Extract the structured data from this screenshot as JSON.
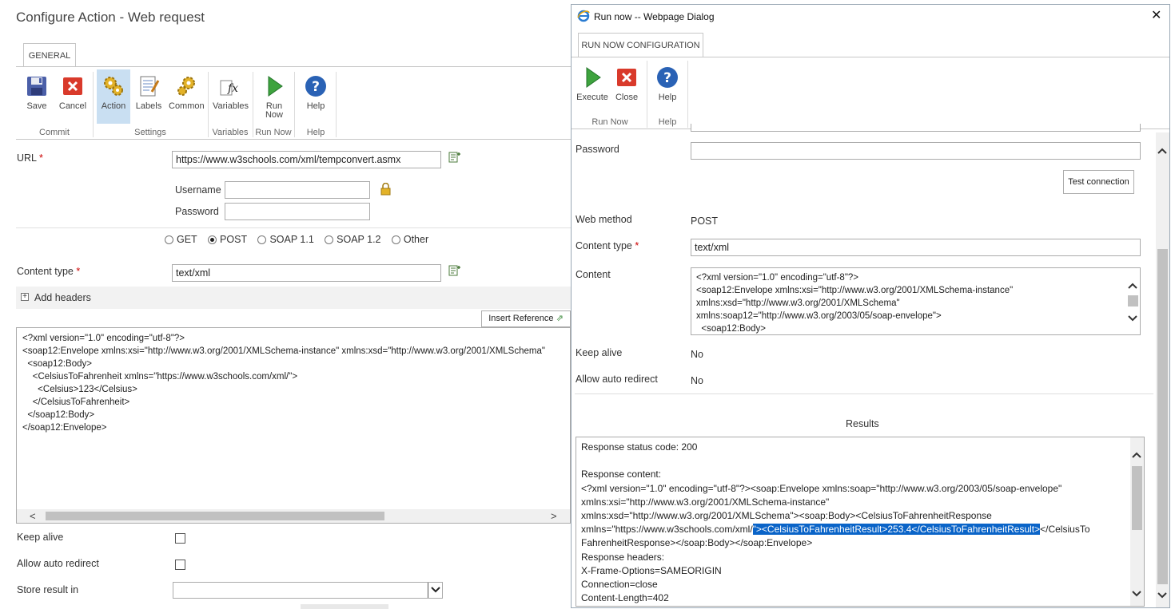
{
  "main": {
    "title": "Configure Action - Web request",
    "tab_general": "GENERAL",
    "ribbon": {
      "save": "Save",
      "cancel": "Cancel",
      "action": "Action",
      "labels": "Labels",
      "common": "Common",
      "variables": "Variables",
      "run_now_1": "Run",
      "run_now_2": "Now",
      "help": "Help",
      "group_commit": "Commit",
      "group_settings": "Settings",
      "group_variables": "Variables",
      "group_run_now": "Run Now",
      "group_help": "Help"
    },
    "url_label": "URL",
    "url_value": "https://www.w3schools.com/xml/tempconvert.asmx",
    "username_label": "Username",
    "password_label": "Password",
    "methods": [
      "GET",
      "POST",
      "SOAP 1.1",
      "SOAP 1.2",
      "Other"
    ],
    "selected_method": "POST",
    "content_type_label": "Content type",
    "content_type_value": "text/xml",
    "add_headers": "Add headers",
    "insert_reference": "Insert Reference",
    "content_lines": [
      "<?xml version=\"1.0\" encoding=\"utf-8\"?>",
      "<soap12:Envelope xmlns:xsi=\"http://www.w3.org/2001/XMLSchema-instance\" xmlns:xsd=\"http://www.w3.org/2001/XMLSchema\"",
      "  <soap12:Body>",
      "    <CelsiusToFahrenheit xmlns=\"https://www.w3schools.com/xml/\">",
      "      <Celsius>123</Celsius>",
      "    </CelsiusToFahrenheit>",
      "  </soap12:Body>",
      "</soap12:Envelope>"
    ],
    "keep_alive_label": "Keep alive",
    "allow_redirect_label": "Allow auto redirect",
    "store_result_label": "Store result in"
  },
  "dialog": {
    "title": "Run now -- Webpage Dialog",
    "tab": "RUN NOW CONFIGURATION",
    "ribbon": {
      "execute": "Execute",
      "close": "Close",
      "help": "Help",
      "group_run_now": "Run Now",
      "group_help": "Help"
    },
    "password_label": "Password",
    "test_connection": "Test connection",
    "web_method_label": "Web method",
    "web_method_value": "POST",
    "content_type_label": "Content type",
    "content_type_value": "text/xml",
    "content_label": "Content",
    "content_lines": [
      "<?xml version=\"1.0\" encoding=\"utf-8\"?>",
      "<soap12:Envelope xmlns:xsi=\"http://www.w3.org/2001/XMLSchema-instance\"",
      "xmlns:xsd=\"http://www.w3.org/2001/XMLSchema\"",
      "xmlns:soap12=\"http://www.w3.org/2003/05/soap-envelope\">",
      "  <soap12:Body>"
    ],
    "keep_alive_label": "Keep alive",
    "keep_alive_value": "No",
    "allow_redirect_label": "Allow auto redirect",
    "allow_redirect_value": "No",
    "results_label": "Results",
    "results": {
      "status": "Response status code: 200",
      "content_label": "Response content:",
      "line1": "<?xml version=\"1.0\" encoding=\"utf-8\"?><soap:Envelope xmlns:soap=\"http://www.w3.org/2003/05/soap-envelope\"",
      "line2": "xmlns:xsi=\"http://www.w3.org/2001/XMLSchema-instance\"",
      "line3": "xmlns:xsd=\"http://www.w3.org/2001/XMLSchema\"><soap:Body><CelsiusToFahrenheitResponse",
      "line4_pre": "xmlns=\"https://www.w3schools.com/xml/",
      "line4_hl": "\"><CelsiusToFahrenheitResult>253.4</CelsiusToFahrenheitResult>",
      "line4_post": "</CelsiusTo",
      "line5": "FahrenheitResponse></soap:Body></soap:Envelope>",
      "headers_label": "Response headers:",
      "h1": "X-Frame-Options=SAMEORIGIN",
      "h2": "Connection=close",
      "h3": "Content-Length=402"
    }
  }
}
